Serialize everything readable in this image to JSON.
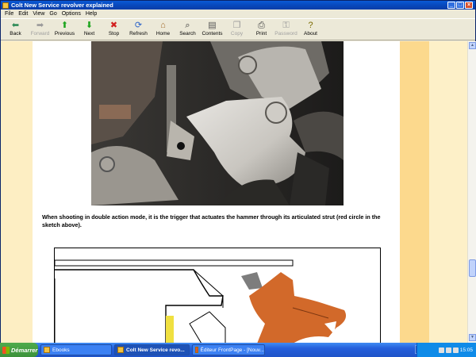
{
  "window": {
    "title": "Colt New Service revolver explained",
    "controls": [
      "_",
      "□",
      "×"
    ]
  },
  "menu": [
    "File",
    "Edit",
    "View",
    "Go",
    "Options",
    "Help"
  ],
  "toolbar": [
    {
      "label": "Back",
      "icon": "arrow-left-icon",
      "glyph": "⬅",
      "color": "#2e8b57",
      "enabled": true
    },
    {
      "label": "Forward",
      "icon": "arrow-right-icon",
      "glyph": "➡",
      "color": "#9a9a9a",
      "enabled": false
    },
    {
      "label": "Previous",
      "icon": "arrow-up-icon",
      "glyph": "⬆",
      "color": "#1fa51f",
      "enabled": true
    },
    {
      "label": "Next",
      "icon": "arrow-down-icon",
      "glyph": "⬇",
      "color": "#1fa51f",
      "enabled": true
    },
    {
      "label": "Stop",
      "icon": "stop-icon",
      "glyph": "✖",
      "color": "#d21f1f",
      "enabled": true
    },
    {
      "label": "Refresh",
      "icon": "refresh-icon",
      "glyph": "⟳",
      "color": "#2a62c9",
      "enabled": true
    },
    {
      "label": "Home",
      "icon": "home-icon",
      "glyph": "⌂",
      "color": "#a06a2a",
      "enabled": true
    },
    {
      "label": "Search",
      "icon": "search-icon",
      "glyph": "⌕",
      "color": "#333333",
      "enabled": true
    },
    {
      "label": "Contents",
      "icon": "contents-icon",
      "glyph": "▤",
      "color": "#555555",
      "enabled": true
    },
    {
      "label": "Copy",
      "icon": "copy-icon",
      "glyph": "❐",
      "color": "#9a9a9a",
      "enabled": false
    },
    {
      "label": "Print",
      "icon": "print-icon",
      "glyph": "⎙",
      "color": "#444444",
      "enabled": true
    },
    {
      "label": "Password",
      "icon": "password-icon",
      "glyph": "⚿",
      "color": "#9a9a9a",
      "enabled": false
    },
    {
      "label": "About",
      "icon": "about-icon",
      "glyph": "?",
      "color": "#7a6a00",
      "enabled": true
    }
  ],
  "content": {
    "caption": "When shooting in double action mode, it is the trigger that actuates the hammer through its articulated strut (red circle in the sketch above)."
  },
  "taskbar": {
    "start_label": "Démarrer",
    "tasks": [
      {
        "label": "Ebooks",
        "active": false
      },
      {
        "label": "Colt New Service revo...",
        "active": true
      },
      {
        "label": "Éditeur FrontPage - [Nouv...",
        "active": false
      }
    ],
    "language": "FR",
    "clock": "15:05"
  },
  "colors": {
    "page_bg": "#ffffff",
    "left_stripe": "#fdeec3",
    "right_stripe": "#fcd98d",
    "sketch_orange": "#d2692a",
    "sketch_yellow": "#f0e040"
  }
}
